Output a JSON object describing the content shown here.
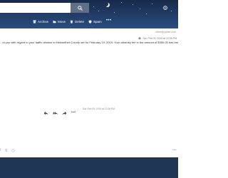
{
  "header": {
    "search": {
      "value": "",
      "placeholder": ""
    },
    "search_icon": "search-icon",
    "settings_icon": "gear-icon",
    "toolbar": {
      "archive_label": "Archive",
      "move_label": "Move",
      "delete_label": "Delete",
      "spam_label": "Spam",
      "more_label": "•••"
    }
  },
  "message": {
    "from_address": "office@yprize.com",
    "received_meta": "Sat, Feb 09, 2019 at 12:06 PM",
    "body_text": "...nt you with regard to your traffic citation in Meriwether County set for February 19, 2019.  Your attorney fee in the amount of $350.00 has been paid in full by...",
    "date_line": "Sat, Feb 09, 2019 at 12:06 PM",
    "actions_more": "•••"
  },
  "compose": {
    "format_bold_label": "B",
    "format_italic_label": "I",
    "more_label": "•••"
  },
  "colors": {
    "header_dark": "#172a4a",
    "header_light": "#2b4d80",
    "search_button": "#5f6f87",
    "pane_background": "#ffffff",
    "footer": "#1f3556"
  }
}
